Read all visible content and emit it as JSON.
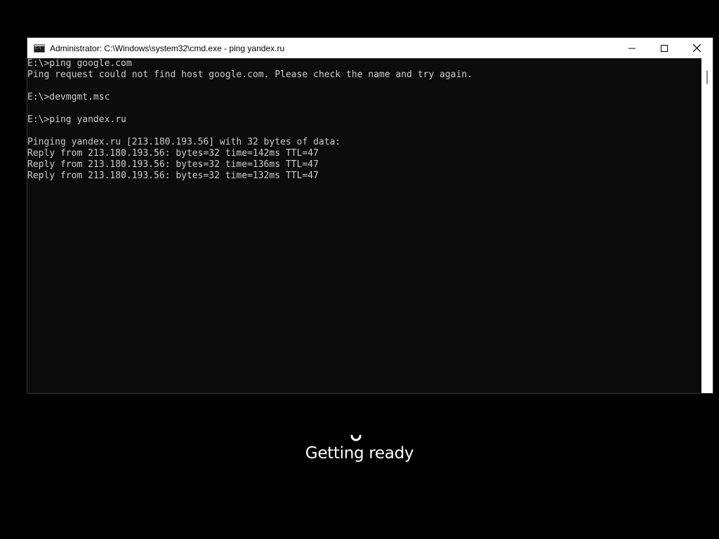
{
  "window": {
    "title": "Administrator: C:\\Windows\\system32\\cmd.exe - ping  yandex.ru",
    "app_icon": "cmd-icon",
    "controls": {
      "minimize_icon": "minimize-icon",
      "maximize_icon": "maximize-icon",
      "close_icon": "close-icon"
    }
  },
  "console": {
    "lines": [
      "E:\\>ping google.com",
      "Ping request could not find host google.com. Please check the name and try again.",
      "",
      "E:\\>devmgmt.msc",
      "",
      "E:\\>ping yandex.ru",
      "",
      "Pinging yandex.ru [213.180.193.56] with 32 bytes of data:",
      "Reply from 213.180.193.56: bytes=32 time=142ms TTL=47",
      "Reply from 213.180.193.56: bytes=32 time=136ms TTL=47",
      "Reply from 213.180.193.56: bytes=32 time=132ms TTL=47"
    ]
  },
  "overlay": {
    "spinner_icon": "loading-spinner-icon",
    "status_text": "Getting ready"
  },
  "colors": {
    "desktop_background": "#000000",
    "console_background": "#0c0c0c",
    "console_text": "#cccccc",
    "titlebar_background": "#ffffff",
    "status_text": "#ffffff"
  }
}
